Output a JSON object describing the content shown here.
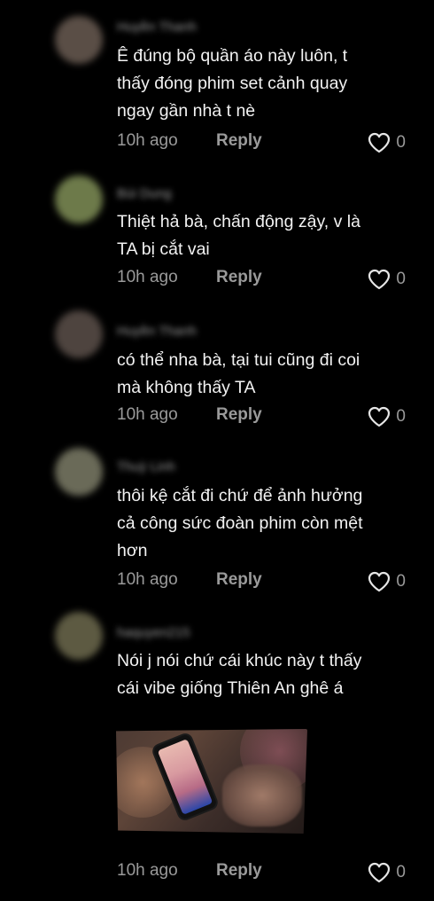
{
  "comments": [
    {
      "username": "Huyền Thanh",
      "text": "Ê đúng bộ quần áo này luôn, t\nthấy đóng phim set cảnh quay\nngay gần nhà t nè",
      "time": "10h ago",
      "reply": "Reply",
      "likes": "0",
      "avatar_color": "#5a4e46"
    },
    {
      "username": "Bùi Dung",
      "text": "Thiệt hả bà, chấn động zậy, v là\nTA bị cắt vai",
      "time": "10h ago",
      "reply": "Reply",
      "likes": "0",
      "avatar_color": "#6d7a4a"
    },
    {
      "username": "Huyền Thanh",
      "text": "có thể nha bà, tại tui cũng đi coi\nmà không thấy TA",
      "time": "10h ago",
      "reply": "Reply",
      "likes": "0",
      "avatar_color": "#4e443f"
    },
    {
      "username": "Thuỳ Linh",
      "text": "thôi kệ cắt đi chứ để ảnh hưởng\ncả công sức đoàn phim còn mệt\nhơn",
      "time": "10h ago",
      "reply": "Reply",
      "likes": "0",
      "avatar_color": "#6a6a58"
    },
    {
      "username": "haquyen215",
      "text": "Nói j nói chứ cái khúc này t thấy\ncái vibe giống Thiên An ghê á",
      "time": "10h ago",
      "reply": "Reply",
      "likes": "0",
      "avatar_color": "#5d5a42",
      "has_image": true
    }
  ],
  "colors": {
    "background": "#000000",
    "text": "#f2f2f2",
    "secondary": "#9a9a9a"
  },
  "icons": {
    "like": "heart-outline-icon"
  }
}
